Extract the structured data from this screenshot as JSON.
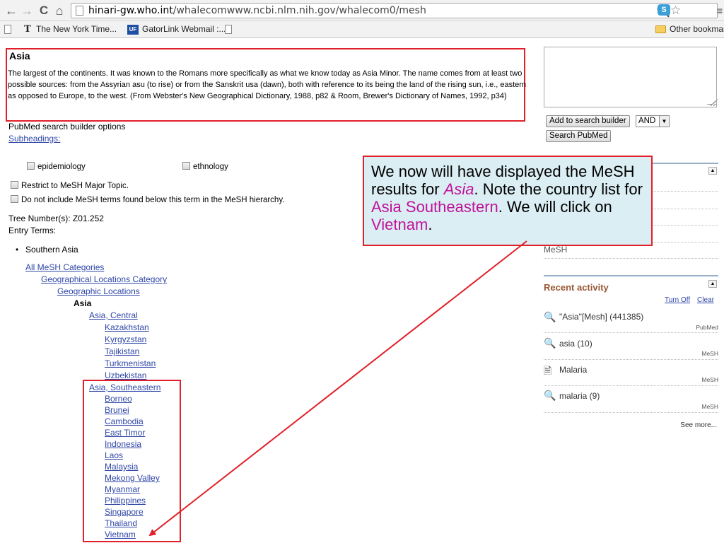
{
  "browser": {
    "nav": {
      "back": "←",
      "forward": "→",
      "reload": "C",
      "home": "⌂"
    },
    "url_host": "hinari-gw.who.int",
    "url_path": "/whalecomwww.ncbi.nlm.nih.gov/whalecom0/mesh",
    "bookmarks": [
      "The New York Time...",
      "GatorLink Webmail :...",
      "Other bookmar"
    ]
  },
  "term": {
    "title": "Asia",
    "scope_note": "The largest of the continents. It was known to the Romans more specifically as what we know today as Asia Minor. The name comes from at least two possible sources: from the Assyrian asu (to rise) or from the Sanskrit usa (dawn), both with reference to its being the land of the rising sun, i.e., eastern as opposed to Europe, to the west. (From Webster's New Geographical Dictionary, 1988, p82 & Room, Brewer's Dictionary of Names, 1992, p34)",
    "builder_options": "PubMed search builder options",
    "subheadings_label": "Subheadings:",
    "subheadings": [
      "epidemiology",
      "ethnology"
    ],
    "restrict_major": "Restrict to MeSH Major Topic.",
    "no_explode": "Do not include MeSH terms found below this term in the MeSH hierarchy.",
    "tree_number": "Tree Number(s): Z01.252",
    "entry_terms_label": "Entry Terms:",
    "entry_terms": [
      "Southern Asia"
    ]
  },
  "tree": {
    "all_categories": "All MeSH Categories",
    "geo_category": "Geographical Locations Category",
    "geo_locations": "Geographic Locations",
    "current": "Asia",
    "central": "Asia, Central",
    "central_children": [
      "Kazakhstan",
      "Kyrgyzstan",
      "Tajikistan",
      "Turkmenistan",
      "Uzbekistan"
    ],
    "southeastern": "Asia, Southeastern",
    "southeastern_children": [
      "Borneo",
      "Brunei",
      "Cambodia",
      "East Timor",
      "Indonesia",
      "Laos",
      "Malaysia",
      "Mekong Valley",
      "Myanmar",
      "Philippines",
      "Singapore",
      "Thailand",
      "Vietnam"
    ]
  },
  "sidebar": {
    "query_value": "",
    "add_button": "Add to search builder",
    "operator": "AND",
    "search_button": "Search PubMed",
    "mesh_link": "MeSH",
    "recent_title": "Recent activity",
    "turn_off": "Turn Off",
    "clear": "Clear",
    "recent": [
      {
        "icon": "search-icon",
        "text": "\"Asia\"[Mesh] (441385)",
        "db": "PubMed"
      },
      {
        "icon": "search-icon",
        "text": "asia (10)",
        "db": "MeSH"
      },
      {
        "icon": "document-icon",
        "text": "Malaria",
        "db": "MeSH"
      },
      {
        "icon": "search-icon",
        "text": "malaria (9)",
        "db": "MeSH"
      }
    ],
    "see_more": "See more..."
  },
  "callout": {
    "part1": "We now will have displayed the MeSH results for ",
    "asia": "Asia",
    "part2": ".  Note the country list for ",
    "southeastern": "Asia Southeastern",
    "part3": ". We will click on ",
    "vietnam": "Vietnam",
    "part4": "."
  },
  "colors": {
    "annotation_red": "#e0202a",
    "callout_bg": "#dbeef3",
    "highlight_magenta": "#c0129a",
    "link_blue": "#2f47a7"
  }
}
